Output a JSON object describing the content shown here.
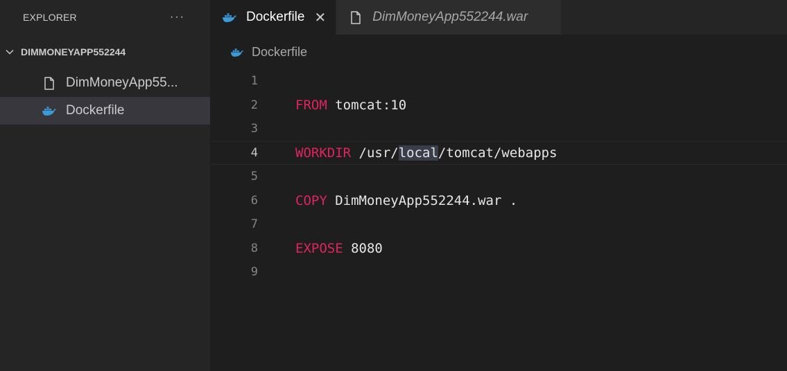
{
  "sidebar": {
    "header": "EXPLORER",
    "more_label": "···",
    "section": "DIMMONEYAPP552244",
    "items": [
      {
        "label": "DimMoneyApp55...",
        "icon": "file-icon",
        "selected": false
      },
      {
        "label": "Dockerfile",
        "icon": "docker-icon",
        "selected": true
      }
    ]
  },
  "tabs": [
    {
      "label": "Dockerfile",
      "icon": "docker-icon",
      "active": true,
      "close": "✕"
    },
    {
      "label": "DimMoneyApp552244.war",
      "icon": "file-icon",
      "active": false
    }
  ],
  "breadcrumb": {
    "label": "Dockerfile",
    "icon": "docker-icon"
  },
  "editor": {
    "current_line": 4,
    "lines": [
      {
        "num": "1",
        "kw": "",
        "rest": ""
      },
      {
        "num": "2",
        "kw": "FROM",
        "rest": " tomcat:10"
      },
      {
        "num": "3",
        "kw": "",
        "rest": ""
      },
      {
        "num": "4",
        "kw": "WORKDIR",
        "rest_pre": " /usr/",
        "rest_hl": "local",
        "rest_post": "/tomcat/webapps"
      },
      {
        "num": "5",
        "kw": "",
        "rest": ""
      },
      {
        "num": "6",
        "kw": "COPY",
        "rest": " DimMoneyApp552244.war ."
      },
      {
        "num": "7",
        "kw": "",
        "rest": ""
      },
      {
        "num": "8",
        "kw": "EXPOSE",
        "rest": " 8080"
      },
      {
        "num": "9",
        "kw": "",
        "rest": ""
      }
    ]
  },
  "colors": {
    "keyword": "#e0245e",
    "docker_blue": "#3b9ad8",
    "background": "#1e1e1e",
    "sidebar": "#252526"
  }
}
